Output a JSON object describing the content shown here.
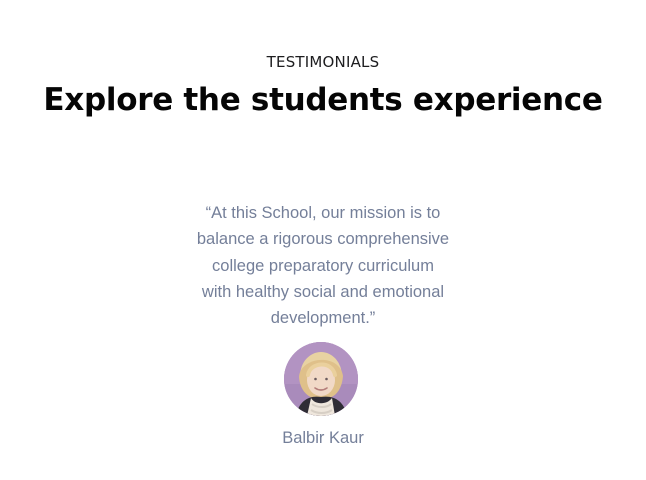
{
  "section": {
    "eyebrow": "TESTIMONIALS",
    "title": "Explore the students experience"
  },
  "testimonial": {
    "quote_lines": [
      "“At this School, our mission is to",
      "balance a rigorous comprehensive",
      "college preparatory curriculum",
      "with healthy social and emotional",
      "development.”"
    ],
    "author_name": "Balbir Kaur",
    "avatar_icon": "person-photo"
  },
  "colors": {
    "heading": "#050505",
    "eyebrow": "#1d1d1f",
    "muted_text": "#747f99",
    "avatar_bg": "#b58fbf"
  }
}
